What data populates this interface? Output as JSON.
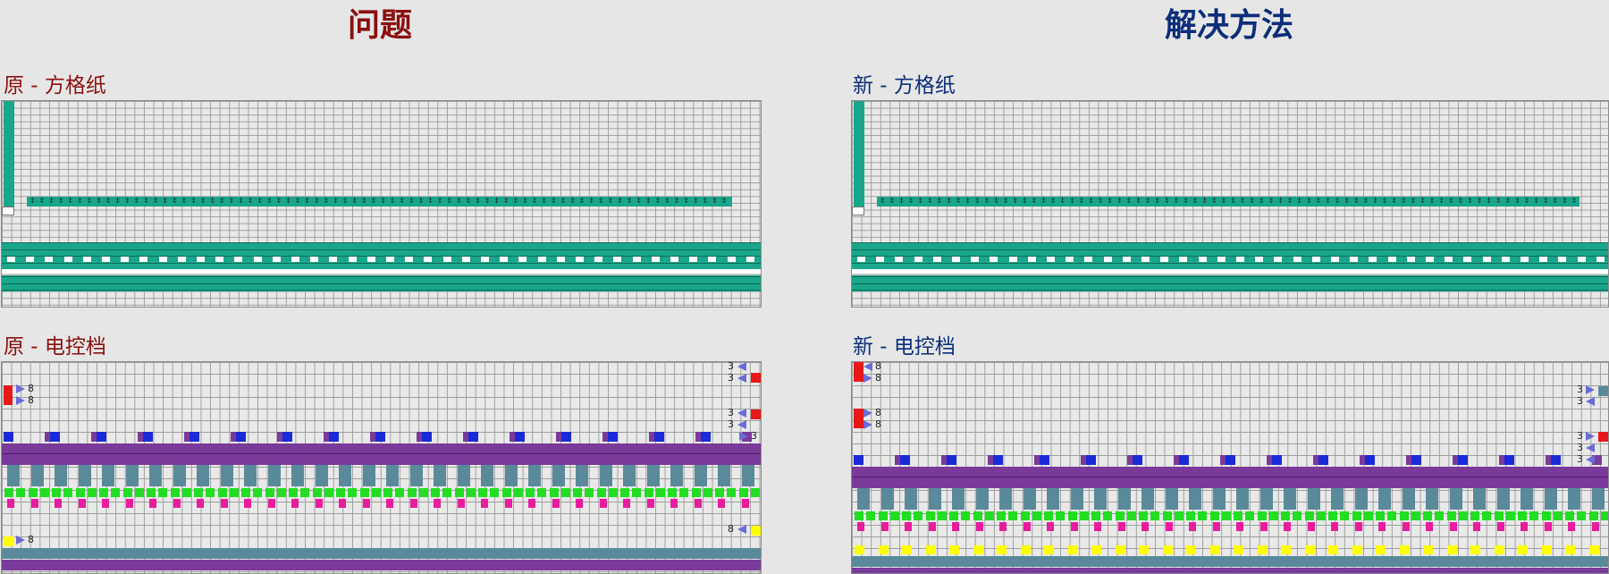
{
  "left": {
    "heading": "问题",
    "heading_color": "#8a1010",
    "grid_title": "原 - 方格纸",
    "ctrl_title": "原 - 电控档",
    "subtitle_color": "#8a1010",
    "arrows": {
      "r8_a": "8",
      "r8_b": "8",
      "l3_a": "3",
      "l3_b": "3",
      "l3_c": "3",
      "l3_d": "3",
      "r3": "3",
      "l8": "8",
      "r8_c": "8"
    }
  },
  "right": {
    "heading": "解决方法",
    "heading_color": "#0d2e7a",
    "grid_title": "新 - 方格纸",
    "ctrl_title": "新 - 电控档",
    "subtitle_color": "#0d2e7a",
    "arrows": {
      "r8_a": "8",
      "r8_b": "8",
      "r8_c": "8",
      "r8_d": "8",
      "l3_a": "3",
      "l3_b": "3",
      "r3_a": "3",
      "l3_c": "3",
      "l3_d": "3"
    }
  },
  "colors": {
    "teal": "#1aa68a",
    "teal_dark": "#0f6b58",
    "purple": "#7a3a9a",
    "slate": "#5a8a9a",
    "green": "#22dd22",
    "magenta": "#e81c9c",
    "yellow": "#ffff00",
    "blue": "#1a2ad8",
    "red": "#e81818"
  }
}
